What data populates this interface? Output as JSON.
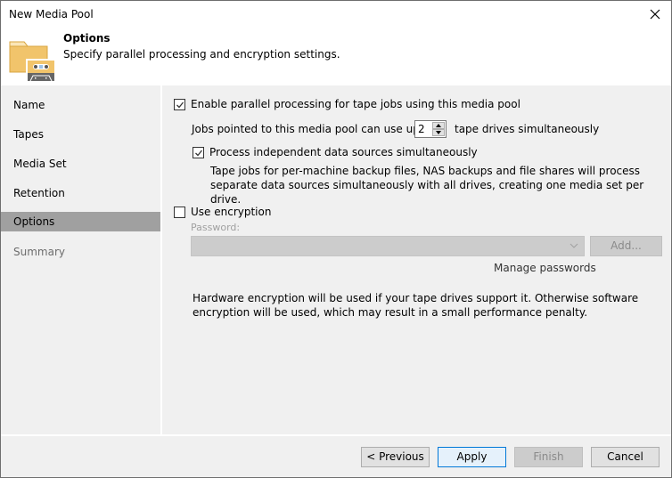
{
  "window": {
    "title": "New Media Pool",
    "close_icon": "close-icon"
  },
  "header": {
    "icon": "media-pool-folder-tape-icon",
    "title": "Options",
    "subtitle": "Specify parallel processing and encryption settings."
  },
  "sidebar": {
    "items": [
      {
        "label": "Name",
        "state": "normal"
      },
      {
        "label": "Tapes",
        "state": "normal"
      },
      {
        "label": "Media Set",
        "state": "normal"
      },
      {
        "label": "Retention",
        "state": "normal"
      },
      {
        "label": "Options",
        "state": "active"
      },
      {
        "label": "Summary",
        "state": "disabled"
      }
    ]
  },
  "options": {
    "parallel": {
      "label": "Enable parallel processing for tape jobs using this media pool",
      "checked": true,
      "drives_prefix": "Jobs pointed to this media pool can use up to",
      "drives_value": "2",
      "drives_suffix": "tape drives simultaneously",
      "independent": {
        "label": "Process independent data sources simultaneously",
        "checked": true,
        "description": "Tape jobs for per-machine backup files, NAS backups and file shares will process separate data sources simultaneously with all drives, creating one media set per drive."
      }
    },
    "encryption": {
      "label": "Use encryption",
      "checked": false,
      "password_label": "Password:",
      "password_value": "",
      "add_button": "Add...",
      "manage_link": "Manage passwords",
      "note": "Hardware encryption will be used if your tape drives support it. Otherwise software encryption will be used, which may result in a small performance penalty."
    }
  },
  "footer": {
    "previous": "< Previous",
    "apply": "Apply",
    "finish": "Finish",
    "cancel": "Cancel"
  },
  "colors": {
    "active_nav": "#a0a0a0",
    "primary_border": "#0078d7",
    "primary_bg": "#e5f1fb",
    "disabled_bg": "#cccccc"
  }
}
